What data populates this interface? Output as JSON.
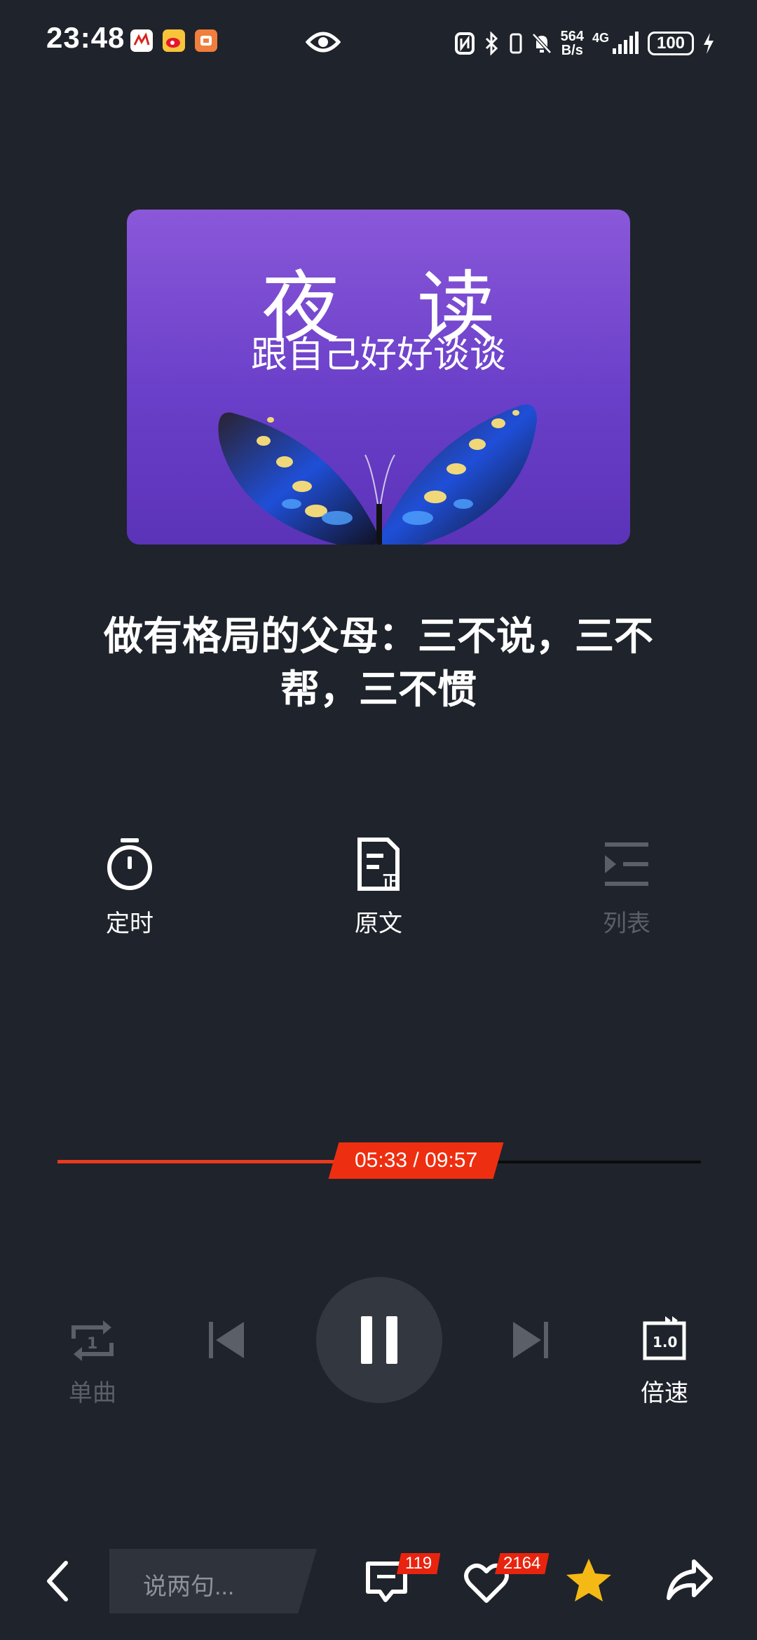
{
  "status_bar": {
    "time": "23:48",
    "net_speed_value": "564",
    "net_speed_unit": "B/s",
    "network": "4G",
    "battery": "100"
  },
  "cover": {
    "title": "夜读",
    "subtitle": "跟自己好好谈谈"
  },
  "episode": {
    "title": "做有格局的父母：三不说，三不帮，三不惯"
  },
  "features": {
    "timer": "定时",
    "original": "原文",
    "playlist": "列表"
  },
  "progress": {
    "current": "05:33",
    "total": "09:57",
    "display": "05:33 / 09:57",
    "fraction": 0.557
  },
  "controls": {
    "repeat_label": "单曲",
    "speed_label": "倍速",
    "speed_value": "1.0"
  },
  "bottom_bar": {
    "comment_placeholder": "说两句...",
    "comment_count": "119",
    "like_count": "2164"
  },
  "colors": {
    "background": "#1f232b",
    "accent": "#ee2e10",
    "star": "#f5b916",
    "cover_purple": "#7a4bd2"
  }
}
